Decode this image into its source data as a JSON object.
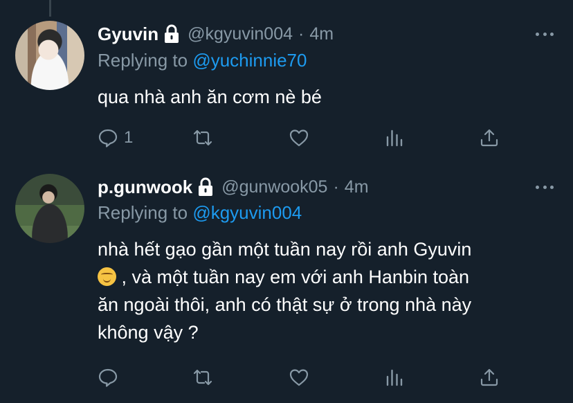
{
  "tweets": [
    {
      "display_name": "Gyuvin",
      "handle": "@kgyuvin004",
      "separator": "·",
      "time": "4m",
      "reply_prefix": "Replying to",
      "reply_to": "@yuchinnie70",
      "text": "qua nhà anh ăn cơm nè bé",
      "reply_count": "1",
      "avatar_icon": "user-avatar-photo",
      "locked_icon": "lock-icon"
    },
    {
      "display_name": "p.gunwook",
      "handle": "@gunwook05",
      "separator": "·",
      "time": "4m",
      "reply_prefix": "Replying to",
      "reply_to": "@kgyuvin004",
      "text_line1": "nhà hết gạo gần một tuần nay rồi anh Gyuvin",
      "text_line2": ", và một tuần nay em với anh Hanbin toàn",
      "text_line3": "ăn ngoài thôi, anh có thật sự ở trong nhà này",
      "text_line4": "không vậy ?",
      "reply_count": "",
      "avatar_icon": "user-avatar-photo",
      "locked_icon": "lock-icon"
    }
  ],
  "colors": {
    "background": "#15202b",
    "secondary_text": "#8899a6",
    "accent": "#1d9bf0"
  }
}
